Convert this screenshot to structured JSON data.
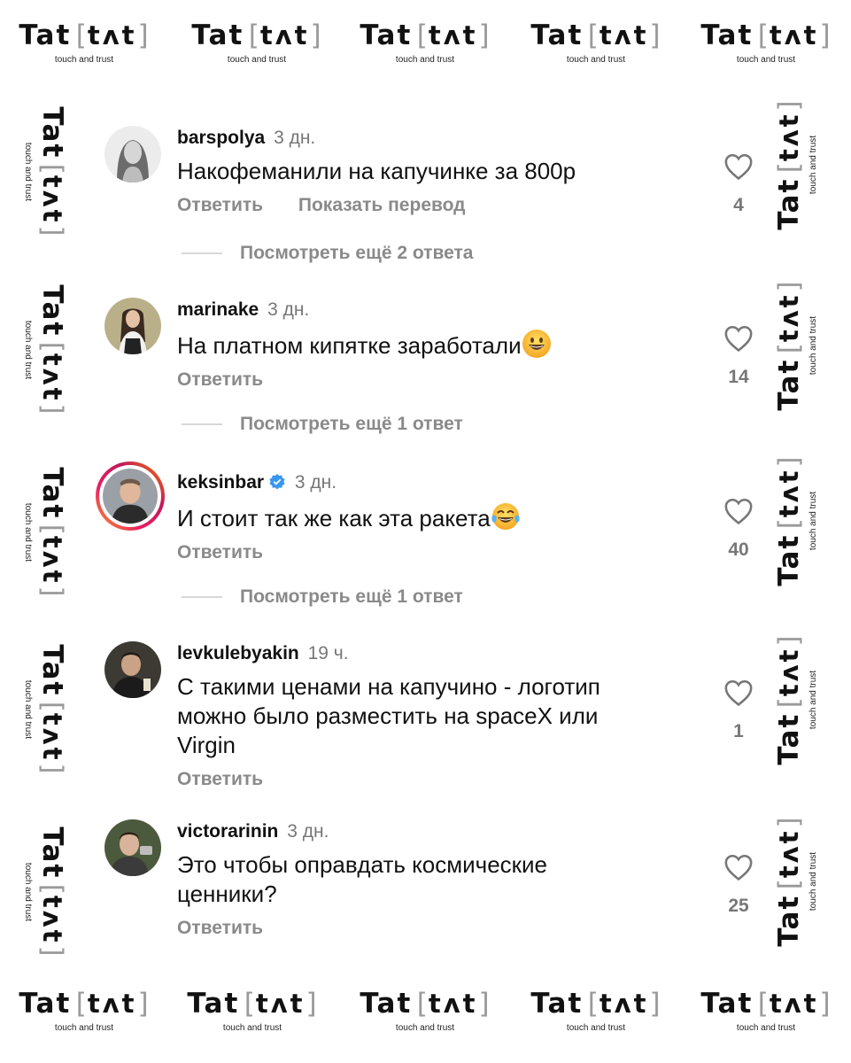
{
  "watermark": {
    "brand": "Tat",
    "inner": "tʌt",
    "bracket_open": "[",
    "bracket_close": "]",
    "tagline": "touch and trust"
  },
  "comments": [
    {
      "username": "barspolya",
      "time": "3 дн.",
      "text": "Накофеманили на капучинке за 800р",
      "reply_label": "Ответить",
      "translate_label": "Показать перевод",
      "likes": "4",
      "more_replies": "Посмотреть ещё 2 ответа"
    },
    {
      "username": "marinake",
      "time": "3 дн.",
      "text": "На платном кипятке заработали",
      "reply_label": "Ответить",
      "likes": "14",
      "more_replies": "Посмотреть ещё 1 ответ",
      "emoji": "grinning-face"
    },
    {
      "username": "keksinbar",
      "time": "3 дн.",
      "text": "И стоит так же как эта ракета",
      "reply_label": "Ответить",
      "likes": "40",
      "more_replies": "Посмотреть ещё 1 ответ",
      "emoji": "tears-of-joy-face",
      "verified": true
    },
    {
      "username": "levkulebyakin",
      "time": "19 ч.",
      "text_lines": [
        "С такими ценами на капучино - логотип",
        "можно было разместить на spaceX или",
        "Virgin"
      ],
      "reply_label": "Ответить",
      "likes": "1"
    },
    {
      "username": "victorarinin",
      "time": "3 дн.",
      "text_lines": [
        "Это чтобы оправдать космические",
        "ценники?"
      ],
      "reply_label": "Ответить",
      "likes": "25"
    }
  ],
  "colors": {
    "muted": "#8a8a8a",
    "verified_blue": "#3897f0",
    "story_ring": [
      "#f9a825",
      "#e91e63"
    ]
  },
  "icons": [
    "heart-outline-icon",
    "verified-badge-icon"
  ]
}
